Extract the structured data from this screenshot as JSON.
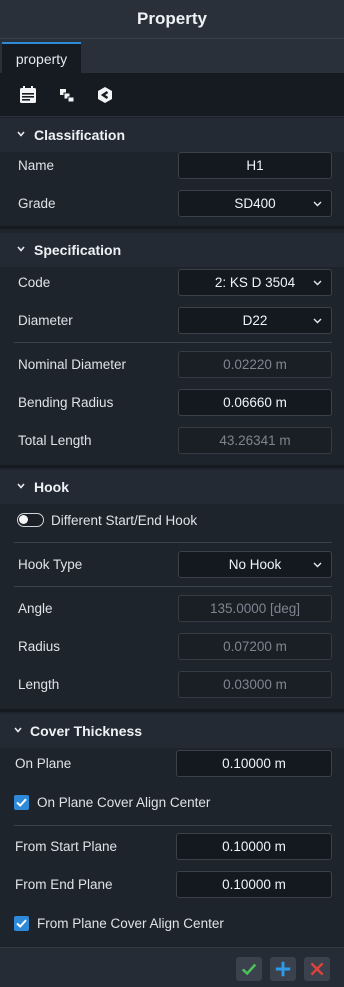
{
  "title": "Property",
  "tabs": [
    {
      "label": "property"
    }
  ],
  "toolbar": {
    "icons": [
      "properties-icon",
      "layers-icon",
      "refresh-icon"
    ]
  },
  "classification": {
    "title": "Classification",
    "name_label": "Name",
    "name_value": "H1",
    "grade_label": "Grade",
    "grade_value": "SD400"
  },
  "specification": {
    "title": "Specification",
    "code_label": "Code",
    "code_value": "2: KS D 3504",
    "diameter_label": "Diameter",
    "diameter_value": "D22",
    "nominal_label": "Nominal Diameter",
    "nominal_value": "0.02220 m",
    "bending_label": "Bending Radius",
    "bending_value": "0.06660 m",
    "total_label": "Total Length",
    "total_value": "43.26341  m"
  },
  "hook": {
    "title": "Hook",
    "toggle_label": "Different Start/End Hook",
    "toggle_on": false,
    "type_label": "Hook Type",
    "type_value": "No Hook",
    "angle_label": "Angle",
    "angle_value": "135.0000 [deg]",
    "radius_label": "Radius",
    "radius_value": "0.07200 m",
    "length_label": "Length",
    "length_value": "0.03000 m"
  },
  "cover": {
    "title": "Cover Thickness",
    "on_plane_label": "On Plane",
    "on_plane_value": "0.10000 m",
    "on_plane_center_label": "On Plane Cover Align Center",
    "on_plane_center_checked": true,
    "start_label": "From Start Plane",
    "start_value": "0.10000 m",
    "end_label": "From End Plane",
    "end_value": "0.10000 m",
    "from_center_label": "From Plane Cover Align Center",
    "from_center_checked": true
  },
  "footer": {
    "buttons": [
      "confirm",
      "add",
      "cancel"
    ]
  },
  "colors": {
    "accent": "#2e89d6",
    "confirm": "#4cc15a",
    "add": "#2e9be8",
    "cancel": "#e0413b"
  }
}
